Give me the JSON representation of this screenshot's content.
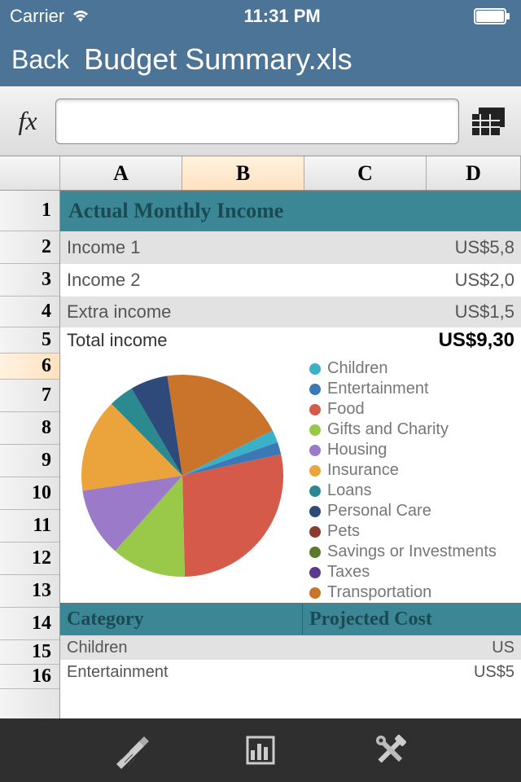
{
  "status": {
    "carrier": "Carrier",
    "time": "11:31 PM"
  },
  "nav": {
    "back": "Back",
    "title": "Budget Summary.xls"
  },
  "formula": {
    "fx": "fx",
    "value": ""
  },
  "columns": [
    "A",
    "B",
    "C",
    "D"
  ],
  "active_column_index": 1,
  "rows": [
    "1",
    "2",
    "3",
    "4",
    "5",
    "6",
    "7",
    "8",
    "9",
    "10",
    "11",
    "12",
    "13",
    "14",
    "15",
    "16"
  ],
  "active_row_index": 5,
  "section1_title": "Actual Monthly Income",
  "income": [
    {
      "label": "Income 1",
      "value": "US$5,8"
    },
    {
      "label": "Income 2",
      "value": "US$2,0"
    },
    {
      "label": "Extra income",
      "value": "US$1,5"
    }
  ],
  "total": {
    "label": "Total income",
    "value": "US$9,30"
  },
  "legend": [
    {
      "name": "Children",
      "color": "#3bb0c9"
    },
    {
      "name": "Entertainment",
      "color": "#3b78b5"
    },
    {
      "name": "Food",
      "color": "#d65a4a"
    },
    {
      "name": "Gifts and Charity",
      "color": "#9ac94a"
    },
    {
      "name": "Housing",
      "color": "#9a7ac9"
    },
    {
      "name": "Insurance",
      "color": "#eaa43b"
    },
    {
      "name": "Loans",
      "color": "#2a8a8f"
    },
    {
      "name": "Personal Care",
      "color": "#2d4a7a"
    },
    {
      "name": "Pets",
      "color": "#8a3a2f"
    },
    {
      "name": "Savings or Investments",
      "color": "#5a7a2a"
    },
    {
      "name": "Taxes",
      "color": "#5a3a8a"
    },
    {
      "name": "Transportation",
      "color": "#c9742a"
    }
  ],
  "cat_header": {
    "c1": "Category",
    "c2": "Projected Cost"
  },
  "categories": [
    {
      "label": "Children",
      "value": "US"
    },
    {
      "label": "Entertainment",
      "value": "US$5"
    }
  ],
  "chart_data": {
    "type": "pie",
    "title": "",
    "series": [
      {
        "name": "Transportation",
        "value": 20,
        "color": "#c9742a"
      },
      {
        "name": "Children",
        "value": 2,
        "color": "#3bb0c9"
      },
      {
        "name": "Entertainment",
        "value": 2,
        "color": "#3b78b5"
      },
      {
        "name": "Food",
        "value": 28,
        "color": "#d65a4a"
      },
      {
        "name": "Gifts and Charity",
        "value": 12,
        "color": "#9ac94a"
      },
      {
        "name": "Housing",
        "value": 11,
        "color": "#9a7ac9"
      },
      {
        "name": "Insurance",
        "value": 15,
        "color": "#eaa43b"
      },
      {
        "name": "Loans",
        "value": 4,
        "color": "#2a8a8f"
      },
      {
        "name": "Personal Care",
        "value": 6,
        "color": "#2d4a7a"
      }
    ]
  },
  "icons": {
    "wifi": "wifi-icon",
    "battery": "battery-icon",
    "sheets": "sheets-icon",
    "tool1": "format-icon",
    "tool2": "chart-icon",
    "tool3": "tools-icon"
  }
}
